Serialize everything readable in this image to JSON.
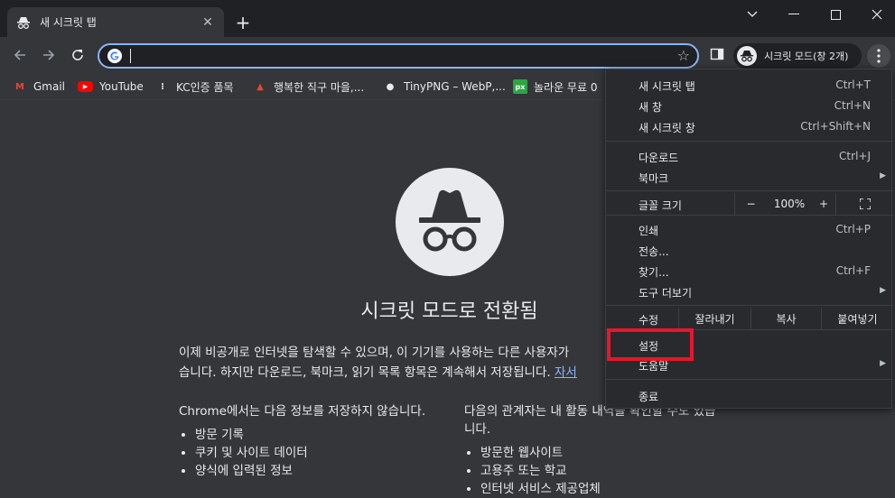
{
  "tab": {
    "title": "새 시크릿 탭",
    "close_label": "✕"
  },
  "newtab_label": "+",
  "window_controls": {
    "down": "⌄",
    "minimize": "—",
    "maximize": "☐",
    "close": "✕"
  },
  "omnibox": {
    "value": "",
    "star": "☆"
  },
  "profile_label": "시크릿 모드(창 2개)",
  "bookmarks": [
    {
      "label": "Gmail",
      "icon": "M",
      "color": "#ea4335"
    },
    {
      "label": "YouTube",
      "icon": "▶",
      "color": "#ff0000"
    },
    {
      "label": "KC인증 품목",
      "icon": "⁝",
      "color": "#e8eaed"
    },
    {
      "label": "행복한 직구 마을,...",
      "icon": "▲",
      "color": "#e8482c"
    },
    {
      "label": "TinyPNG – WebP,...",
      "icon": "●",
      "color": "#e8eaed"
    },
    {
      "label": "놀라운 무료 0",
      "icon": "px",
      "color": "#2aa742"
    }
  ],
  "page": {
    "title": "시크릿 모드로 전환됨",
    "intro_line1": "이제 비공개로 인터넷을 탐색할 수 있으며, 이 기기를 사용하는 다른 사용자가",
    "intro_line2": "습니다. 하지만 다운로드, 북마크, 읽기 목록 항목은 계속해서 저장됩니다.",
    "intro_link": "자서",
    "col1_heading": "Chrome에서는 다음 정보를 저장하지 않습니다.",
    "col1_items": [
      "방문 기록",
      "쿠키 및 사이트 데이터",
      "양식에 입력된 정보"
    ],
    "col2_heading": "다음의 관계자는 내 활동 내역을 확인할 수도 있습니다.",
    "col2_items": [
      "방문한 웹사이트",
      "고용주 또는 학교",
      "인터넷 서비스 제공업체"
    ]
  },
  "menu": {
    "new_tab": {
      "label": "새 시크릿 탭",
      "shortcut": "Ctrl+T"
    },
    "new_window": {
      "label": "새 창",
      "shortcut": "Ctrl+N"
    },
    "new_incognito": {
      "label": "새 시크릿 창",
      "shortcut": "Ctrl+Shift+N"
    },
    "downloads": {
      "label": "다운로드",
      "shortcut": "Ctrl+J"
    },
    "bookmarks": {
      "label": "북마크"
    },
    "zoom": {
      "label": "글꼴 크기",
      "minus": "−",
      "value": "100%",
      "plus": "+",
      "fullscreen": "⛶"
    },
    "print": {
      "label": "인쇄",
      "shortcut": "Ctrl+P"
    },
    "cast": {
      "label": "전송..."
    },
    "find": {
      "label": "찾기...",
      "shortcut": "Ctrl+F"
    },
    "more_tools": {
      "label": "도구 더보기"
    },
    "edit": {
      "label": "수정",
      "cut": "잘라내기",
      "copy": "복사",
      "paste": "붙여넣기"
    },
    "settings": {
      "label": "설정"
    },
    "help": {
      "label": "도움말"
    },
    "exit": {
      "label": "종료"
    },
    "arrow": "▶"
  }
}
